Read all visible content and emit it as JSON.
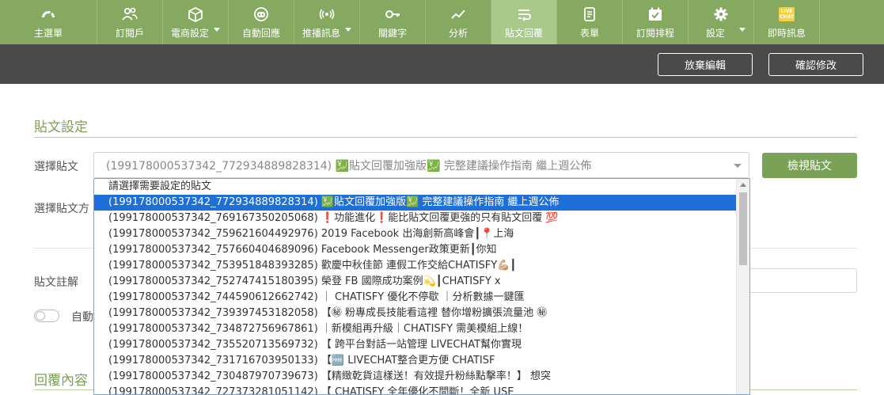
{
  "nav": {
    "items": [
      {
        "label": "主選單",
        "icon": "dashboard-icon"
      },
      {
        "label": "訂閱戶",
        "icon": "users-icon"
      },
      {
        "label": "電商設定",
        "icon": "box-icon"
      },
      {
        "label": "自動回應",
        "icon": "robot-icon"
      },
      {
        "label": "推播訊息",
        "icon": "broadcast-icon"
      },
      {
        "label": "關鍵字",
        "icon": "key-icon"
      },
      {
        "label": "分析",
        "icon": "chart-line-icon"
      },
      {
        "label": "貼文回覆",
        "icon": "reply-icon"
      },
      {
        "label": "表單",
        "icon": "form-icon"
      },
      {
        "label": "訂閱排程",
        "icon": "calendar-check-icon"
      },
      {
        "label": "設定",
        "icon": "gear-icon"
      },
      {
        "label": "即時訊息",
        "icon": "live-chat-icon"
      }
    ],
    "live_badge": "LIVE CHAT"
  },
  "toolbar": {
    "discard_label": "放棄編輯",
    "confirm_label": "確認修改"
  },
  "post_settings": {
    "title": "貼文設定",
    "select_post_label": "選擇貼文",
    "selected_value": "(199178000537342_772934889828314) 💹貼文回覆加強版💹 完整建議操作指南 繼上週公佈",
    "view_post_button": "檢視貼文",
    "select_method_label": "選擇貼文方",
    "note_label": "貼文註解",
    "auto_label": "自動"
  },
  "reply_content": {
    "title": "回覆內容"
  },
  "dropdown": {
    "options": [
      "請選擇需要設定的貼文",
      "(199178000537342_772934889828314) 💹貼文回覆加強版💹 完整建議操作指南 繼上週公佈",
      "(199178000537342_769167350205068) ❗功能進化❗能比貼文回覆更強的只有貼文回覆 💯",
      "(199178000537342_759621604492976) 2019 Facebook 出海創新高峰會┃📍上海",
      "(199178000537342_757660404689096) Facebook Messenger政策更新┃你知",
      "(199178000537342_753951848393285) 歡慶中秋佳節 連假工作交給CHATISFY💪🏼┃",
      "(199178000537342_752747415180395) 榮登 FB 國際成功案例💫┃CHATISFY x",
      "(199178000537342_744590612662742) ｜ CHATISFY 優化不停歇 ｜分析數據一鍵匯",
      "(199178000537342_739397453182058) 【㊙ 粉專成長技能看這裡 替你增粉擴張流量池 ㊙",
      "(199178000537342_734872756967861) ｜新模組再升級｜CHATISFY 需美模組上線！",
      "(199178000537342_735520713569732) 【 跨平台對話一站管理 LIVECHAT幫你實現",
      "(199178000537342_731716703950133) 【🆓 LIVECHAT整合更方便 CHATISF",
      "(199178000537342_730487970739673) 【精緻乾貨這樣送！有效提升粉絲點擊率！】 想突",
      "(199178000537342_727373281051142) 【 CHATISFY 全年優化不間斷！全新 USE"
    ],
    "selected_index": 1
  },
  "colors": {
    "nav_bg": "#86a961",
    "nav_active": "#a8c98a",
    "toolbar_bg": "#4a4a4a",
    "accent": "#7aa256",
    "selected_option": "#1e6fd8"
  }
}
